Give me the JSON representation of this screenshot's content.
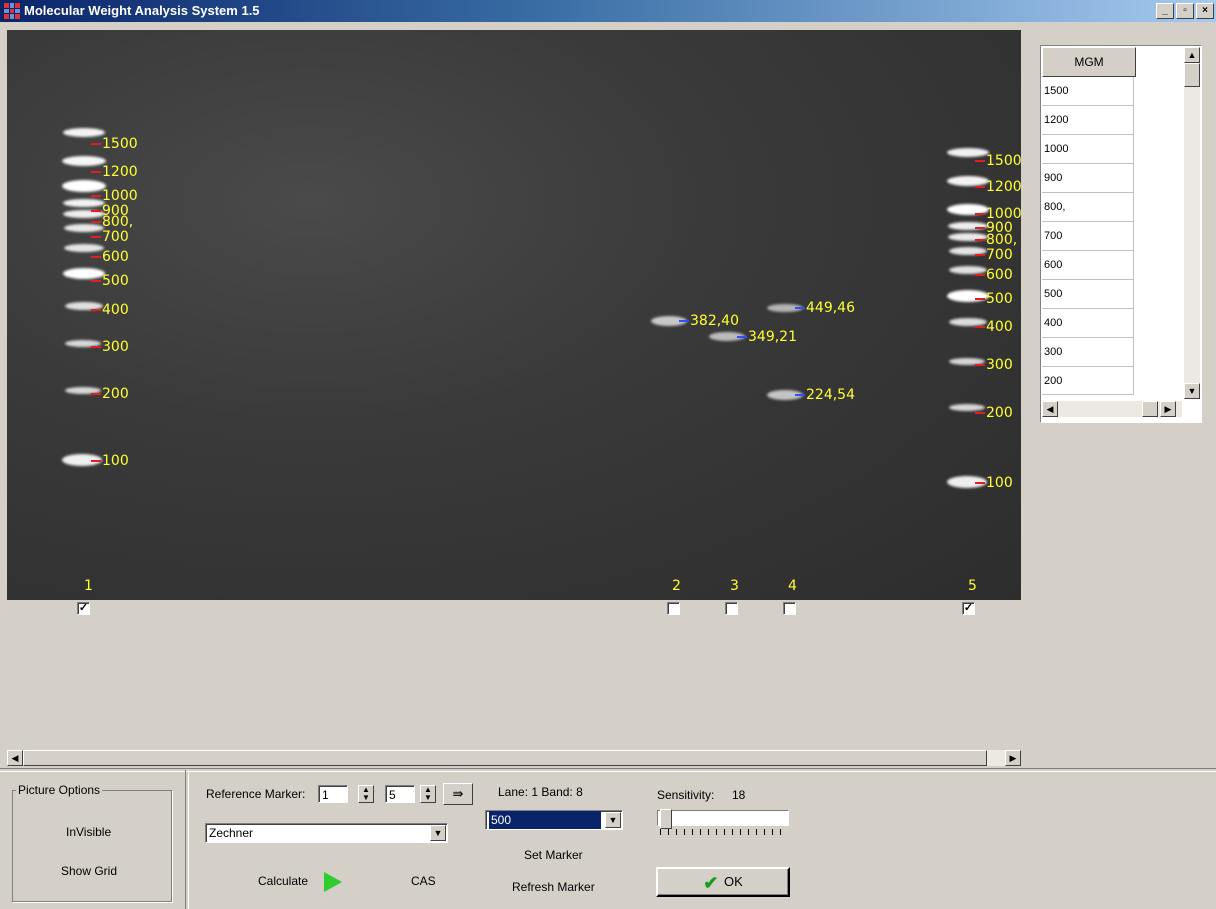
{
  "window": {
    "title": "Molecular Weight Analysis System 1.5",
    "min": "_",
    "max": "▫",
    "close": "×"
  },
  "gel": {
    "lane1_markers": [
      "1500",
      "1200",
      "1000",
      "900",
      "800,",
      "700",
      "600",
      "500",
      "400",
      "300",
      "200",
      "100"
    ],
    "lane5_markers": [
      "1500",
      "1200",
      "1000",
      "900",
      "800,",
      "700",
      "600",
      "500",
      "400",
      "300",
      "200",
      "100"
    ],
    "sample_bands": {
      "b1": "382,40",
      "b2": "349,21",
      "b3": "449,46",
      "b4": "224,54"
    },
    "lane_numbers": [
      "1",
      "2",
      "3",
      "4",
      "5"
    ],
    "lane_checked": [
      true,
      false,
      false,
      false,
      true
    ],
    "check_mark": "✓"
  },
  "grid": {
    "header": "MGM",
    "rows": [
      "1500",
      "1200",
      "1000",
      "900",
      "800,",
      "700",
      "600",
      "500",
      "400",
      "300",
      "200"
    ]
  },
  "picture_options": {
    "title": "Picture Options",
    "invisible": "InVisible",
    "show_grid": "Show Grid"
  },
  "controls": {
    "reference_marker_label": "Reference Marker:",
    "ref_lane_value": "1",
    "ref_count_value": "5",
    "marker_combo_value": "Zechner",
    "calculate_label": "Calculate",
    "cas_label": "CAS",
    "lane_label": "Lane:",
    "lane_value": "1",
    "band_label": "Band:",
    "band_value": "8",
    "band_combo_value": "500",
    "set_marker_label": "Set Marker",
    "refresh_marker_label": "Refresh Marker",
    "sensitivity_label": "Sensitivity:",
    "sensitivity_value": "18",
    "sensitivity_level": 0.02,
    "ok_label": "OK"
  }
}
